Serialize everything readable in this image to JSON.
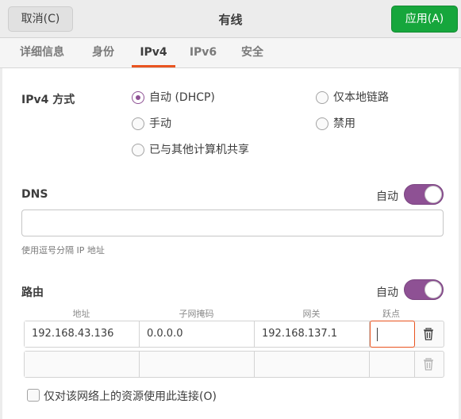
{
  "header": {
    "cancel_label": "取消(C)",
    "title": "有线",
    "apply_label": "应用(A)"
  },
  "tabs": [
    {
      "label": "详细信息"
    },
    {
      "label": "身份"
    },
    {
      "label": "IPv4",
      "active": true
    },
    {
      "label": "IPv6"
    },
    {
      "label": "安全"
    }
  ],
  "ipv4_method": {
    "label": "IPv4 方式",
    "options": [
      {
        "label": "自动 (DHCP)",
        "checked": true
      },
      {
        "label": "仅本地链路",
        "checked": false
      },
      {
        "label": "手动",
        "checked": false
      },
      {
        "label": "禁用",
        "checked": false
      },
      {
        "label": "已与其他计算机共享",
        "checked": false
      }
    ]
  },
  "dns": {
    "label": "DNS",
    "auto_label": "自动",
    "auto_enabled": true,
    "value": "",
    "hint": "使用逗号分隔 IP 地址"
  },
  "routes": {
    "label": "路由",
    "auto_label": "自动",
    "auto_enabled": true,
    "columns": [
      "地址",
      "子网掩码",
      "网关",
      "跃点"
    ],
    "rows": [
      {
        "address": "192.168.43.136",
        "netmask": "0.0.0.0",
        "gateway": "192.168.137.1",
        "metric": ""
      },
      {
        "address": "",
        "netmask": "",
        "gateway": "",
        "metric": ""
      }
    ]
  },
  "only_local_resources": {
    "label": "仅对该网络上的资源使用此连接(O)",
    "checked": false
  },
  "colors": {
    "accent": "#e95420",
    "toggle": "#8e5194",
    "apply": "#16a63c"
  }
}
